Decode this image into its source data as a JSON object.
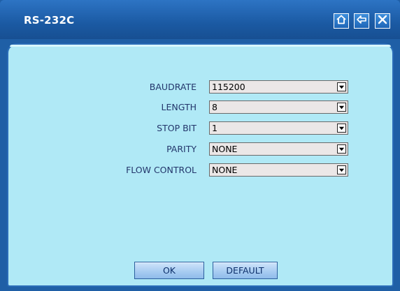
{
  "window": {
    "title": "RS-232C",
    "buttons": [
      {
        "name": "home-button",
        "icon": "home-icon"
      },
      {
        "name": "back-button",
        "icon": "back-arrow-icon"
      },
      {
        "name": "close-button",
        "icon": "close-icon"
      }
    ]
  },
  "settings": [
    {
      "label": "BAUDRATE",
      "value": "115200"
    },
    {
      "label": "LENGTH",
      "value": "8"
    },
    {
      "label": "STOP BIT",
      "value": "1"
    },
    {
      "label": "PARITY",
      "value": "NONE"
    },
    {
      "label": "FLOW CONTROL",
      "value": "NONE"
    }
  ],
  "actions": {
    "ok_label": "OK",
    "default_label": "DEFAULT"
  },
  "colors": {
    "titlebar": "#1b5aa3",
    "panel": "#b0e9f6",
    "label_text": "#23366b",
    "button": "#a9cdf2"
  }
}
